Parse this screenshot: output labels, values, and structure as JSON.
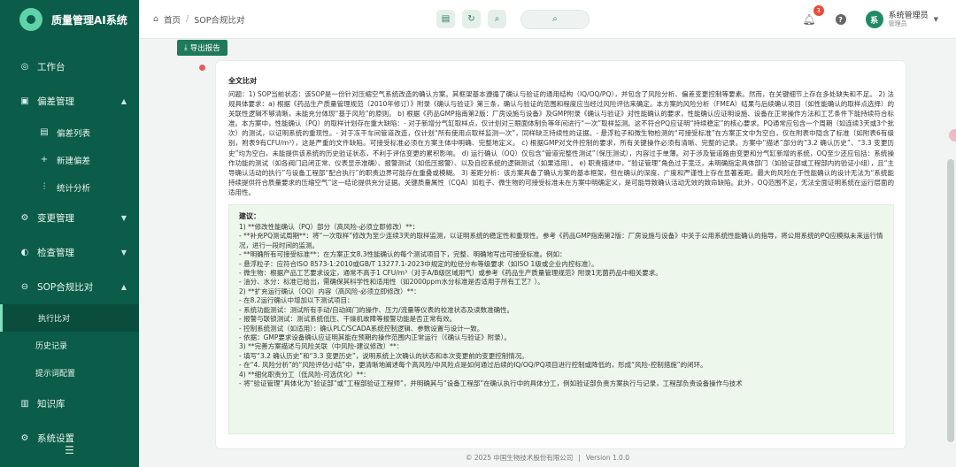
{
  "brand": {
    "title": "质量管理AI系统"
  },
  "sidebar": {
    "items": [
      {
        "label": "工作台",
        "icon": "dashboard-icon"
      },
      {
        "label": "偏差管理",
        "icon": "deviation-icon",
        "expanded": true
      },
      {
        "label": "偏差列表",
        "icon": "list-icon"
      },
      {
        "label": "新建偏差",
        "icon": "plus-icon"
      },
      {
        "label": "统计分析",
        "icon": "chart-icon"
      },
      {
        "label": "变更管理",
        "icon": "change-icon"
      },
      {
        "label": "检查管理",
        "icon": "inspect-icon"
      },
      {
        "label": "SOP合规比对",
        "icon": "sop-icon",
        "expanded": true
      },
      {
        "label": "执行比对",
        "active": true
      },
      {
        "label": "历史记录"
      },
      {
        "label": "提示词配置"
      },
      {
        "label": "知识库",
        "icon": "book-icon"
      },
      {
        "label": "系统设置",
        "icon": "gear-icon"
      }
    ],
    "collapse_icon": "menu-icon"
  },
  "header": {
    "breadcrumb": [
      "首页",
      "SOP合规比对"
    ],
    "notification_count": "3",
    "user": {
      "name": "系统管理员",
      "role": "管理员",
      "avatar": "系"
    }
  },
  "main": {
    "export_label": "导出报告",
    "report": {
      "title": "全文比对",
      "question": "问题：1) SOP当前状态：该SOP是一份针对压缩空气系统改造的确认方案。其框架基本遵循了确认与验证的通用结构（IQ/OQ/PQ），并包含了风险分析、偏差变更控制等要素。然而，在关键细节上存在多处缺失和不足。 2) 法规具体要求：a) 根据《药品生产质量管理规范（2010年修订）》附录《确认与验证》第三条，确认与验证的范围和程度应当经过风险评估来确定。本方案的风险分析（FMEA）结果与后续确认项目（如性能确认的取样点选择）的关联性逻辑不够清晰，未能充分体现“基于风险”的原则。 b) 根据《药品GMP指南第2版：厂房设施与设备》及GMP附录《确认与验证》对性能确认的要求，性能确认应证明设施、设备在正常操作方法和工艺条件下能持续符合标准。本方案中，性能确认（PQ）的取样计划存在重大缺陷：- 对于新增分气缸取样点，仅计划对三眼面体制负等年间进行“一次”取样监测。这不符合PQ应证明“持续稳定”的核心要求。PQ通常应包含一个周期（如连续3天或3个批次）的测试，以证明系统的重现性。- 对于冻干车间管道改造，仅计划“所有使用点取样监测一次”，同样缺乏持续性的证据。- 悬浮粒子和微生物检测的“可接受标准”在方案正文中为空白，仅在附表中隐含了标准（如附表6有级别，附表9有CFU/m³），这是严重的文件缺陷。可接受标准必须在方案主体中明确、完整地定义。 c) 根据GMP对文件控制的要求，所有关键操作必须有清晰、完整的记录。方案中“描述”部分的“3.2 确认历史”、“3.3 变更历史”均为空白，未能提供该系统的历史验证状态，不利于评估变更的累积影响。 d) 运行确认（OQ）仅包含“管道完整性测试”（保压测试），内容过于单薄。对于涉及管道路由变更和分气缸新增的系统，OQ至少还应包括：系统操作功能的测试（如各阀门启闭正常、仪表显示准确）、报警测试（如低压报警）、以及自控系统的逻辑测试（如果适用）。 e) 职责描述中，“验证管理”角色过于宽泛，未明确指定具体部门（如验证部或工程部内的验证小组），且“主导确认活动的执行”与设备工程部“配合执行”的职责边界可能存在重叠或模糊。 3) 差距分析：该方案具备了确认方案的基本框架，但在确认的深度、广度和严谨性上存在显著差距。最大的风险在于性能确认的设计无法为“系统能持续提供符合质量要求的压缩空气”这一结论提供充分证据。关键质量属性（CQA）如粒子、微生物的可接受标准未在方案中明确定义，是可能导致确认活动无效的致命缺陷。此外，OQ范围不足，无法全面证明系统在运行层面的适用性。",
      "suggest_title": "建议：",
      "suggest_lines": [
        "1) **修改性能确认（PQ）部分（高风险-必须立即修改）**：",
        "- **补充PQ测试周期**：将“一次取样”修改为至少连续3天的取样监测，以证明系统的稳定性和重现性。参考《药品GMP指南第2版：厂房设施与设备》中关于公用系统性能确认的指导，将公用系统的PQ应模拟未来运行情况，进行一段时间的监测。",
        "- **明确所有可接受标准**：在方案正文8.3性能确认的每个测试项目下，完整、明确地写出可接受标准。例如：",
        "- 悬浮粒子：应符合ISO 8573-1:2010或GB/T 13277.1-2023中规定的粒径分布等级要求（如ISO 1级或企业内控标准）。",
        "- 微生物：根据产品工艺要求设定，通常不高于1 CFU/m³（对于A/B级区域用气）或参考《药品生产质量管理规范》附录1无菌药品中相关要求。",
        "- 油分、水分：标准已给出，需确保其科学性和适用性（如2000ppm水分标准是否适用于所有工艺？）。",
        "2) **扩充运行确认（OQ）内容（高风险-必须立即修改）**：",
        "- 在8.2运行确认中增加以下测试项目：",
        "- 系统功能测试：测试所有手动/自动阀门的操作、压力/流量等仪表的校准状态及读数准确性。",
        "- 报警与联锁测试：测试系统低压、干燥机故障等报警功能是否正常有效。",
        "- 控制系统测试（如适用）：确认PLC/SCADA系统控制逻辑、参数设置与设计一致。",
        "- 依据：GMP要求设备确认应证明其能在预期的操作范围内正常运行（《确认与验证》附录）。",
        "3) **完善方案描述与风险关联（中风险-建议修改）**：",
        "- 填写“3.2 确认历史”和“3.3 变更历史”，说明系统上次确认的状态和本次变更前的变更控制情况。",
        "- 在“4. 风险分析”的“风险评估小结”中，更清晰地阐述每个高风险/中风险点是如何通过后续的IQ/OQ/PQ项目进行控制或降低的，形成“风险-控制措施”的闭环。",
        "4) **细化职责分工（低风险-可选优化）**：",
        "- 将“验证管理”具体化为“验证部”或“工程部验证工程师”，并明确其与“设备工程部”在确认执行中的具体分工，例如验证部负责方案执行与记录，工程部负责设备操作与技术"
      ]
    }
  },
  "footer": {
    "copyright": "© 2025 中国生物技术股份有限公司",
    "version": "Version 1.0.0"
  }
}
